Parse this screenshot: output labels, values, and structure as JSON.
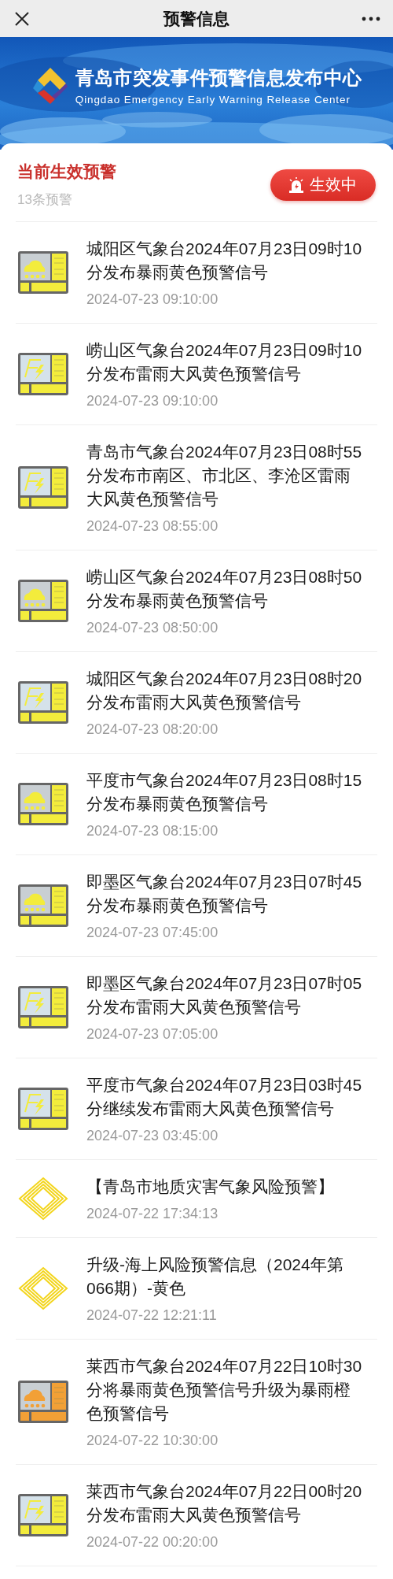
{
  "nav": {
    "title": "预警信息"
  },
  "banner": {
    "kind": "picture",
    "title": "青岛市突发事件预警信息发布中心",
    "subtitle": "Qingdao Emergency Early Warning Release Center"
  },
  "summary": {
    "title": "当前生效预警",
    "count": "13条预警",
    "status_button": "生效中"
  },
  "warnings": [
    {
      "kind": "rainstorm",
      "color": "#f3ec3c",
      "title": "城阳区气象台2024年07月23日09时10分发布暴雨黄色预警信号",
      "time": "2024-07-23 09:10:00"
    },
    {
      "kind": "thunder-wind",
      "color": "#f3ec3c",
      "title": "崂山区气象台2024年07月23日09时10分发布雷雨大风黄色预警信号",
      "time": "2024-07-23 09:10:00"
    },
    {
      "kind": "thunder-wind",
      "color": "#f3ec3c",
      "title": "青岛市气象台2024年07月23日08时55分发布市南区、市北区、李沧区雷雨大风黄色预警信号",
      "time": "2024-07-23 08:55:00"
    },
    {
      "kind": "rainstorm",
      "color": "#f3ec3c",
      "title": "崂山区气象台2024年07月23日08时50分发布暴雨黄色预警信号",
      "time": "2024-07-23 08:50:00"
    },
    {
      "kind": "thunder-wind",
      "color": "#f3ec3c",
      "title": "城阳区气象台2024年07月23日08时20分发布雷雨大风黄色预警信号",
      "time": "2024-07-23 08:20:00"
    },
    {
      "kind": "rainstorm",
      "color": "#f3ec3c",
      "title": "平度市气象台2024年07月23日08时15分发布暴雨黄色预警信号",
      "time": "2024-07-23 08:15:00"
    },
    {
      "kind": "rainstorm",
      "color": "#f3ec3c",
      "title": "即墨区气象台2024年07月23日07时45分发布暴雨黄色预警信号",
      "time": "2024-07-23 07:45:00"
    },
    {
      "kind": "thunder-wind",
      "color": "#f3ec3c",
      "title": "即墨区气象台2024年07月23日07时05分发布雷雨大风黄色预警信号",
      "time": "2024-07-23 07:05:00"
    },
    {
      "kind": "thunder-wind",
      "color": "#f3ec3c",
      "title": "平度市气象台2024年07月23日03时45分继续发布雷雨大风黄色预警信号",
      "time": "2024-07-23 03:45:00"
    },
    {
      "kind": "risk",
      "color": "#f3d51c",
      "title": "【青岛市地质灾害气象风险预警】",
      "time": "2024-07-22 17:34:13"
    },
    {
      "kind": "risk",
      "color": "#f3d51c",
      "title": "升级-海上风险预警信息（2024年第066期）-黄色",
      "time": "2024-07-22 12:21:11"
    },
    {
      "kind": "rainstorm",
      "color": "#f2a036",
      "title": "莱西市气象台2024年07月22日10时30分将暴雨黄色预警信号升级为暴雨橙色预警信号",
      "time": "2024-07-22 10:30:00"
    },
    {
      "kind": "thunder-wind",
      "color": "#f3ec3c",
      "title": "莱西市气象台2024年07月22日00时20分发布雷雨大风黄色预警信号",
      "time": "2024-07-22 00:20:00"
    }
  ]
}
